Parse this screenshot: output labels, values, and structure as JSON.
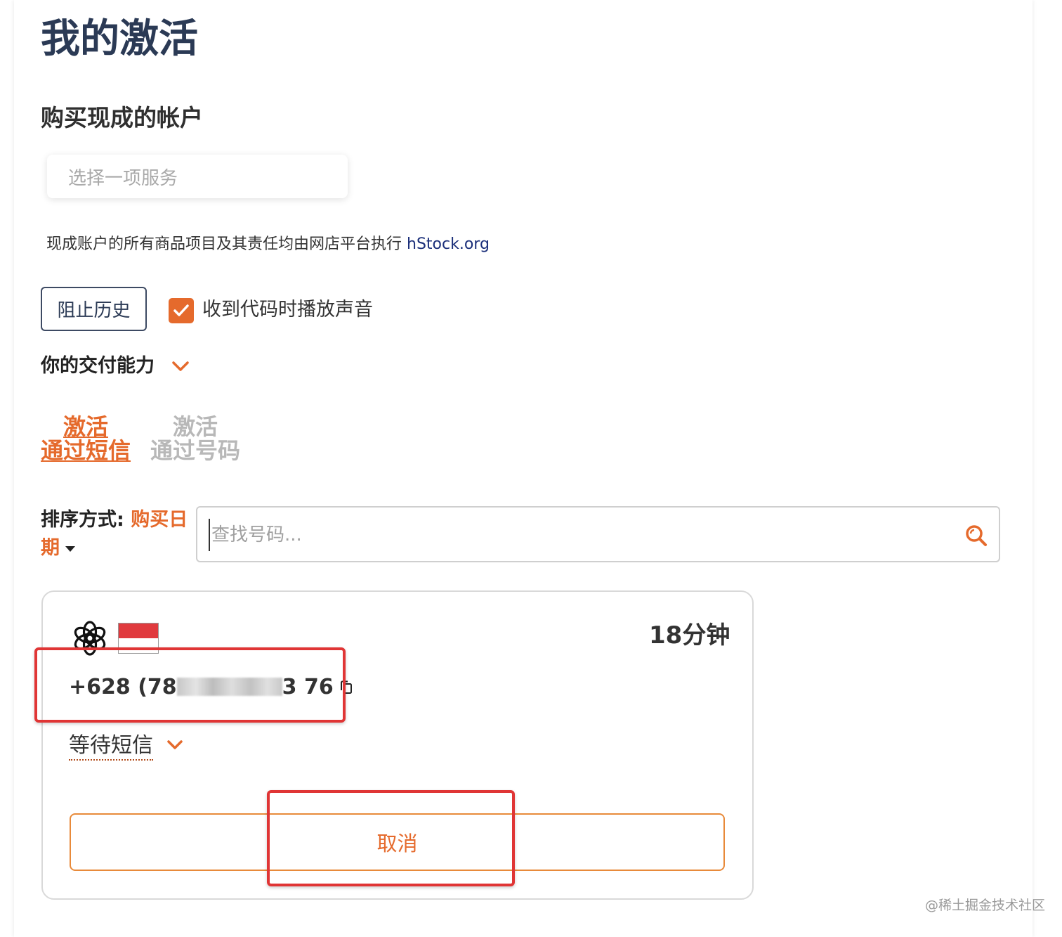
{
  "page": {
    "title": "我的激活",
    "subtitle": "购买现成的帐户"
  },
  "service_select": {
    "placeholder": "选择一项服务"
  },
  "disclaimer": {
    "text": "现成账户的所有商品项目及其责任均由网店平台执行 ",
    "link": "hStock.org"
  },
  "controls": {
    "block_history_label": "阻止历史",
    "sound_checkbox_checked": true,
    "sound_label": "收到代码时播放声音"
  },
  "delivery": {
    "label": "你的交付能力",
    "chevron_icon": "chevron-down-icon"
  },
  "tabs": [
    {
      "line1": "激活",
      "line2": "通过短信",
      "active": true
    },
    {
      "line1": "激活",
      "line2": "通过号码",
      "active": false
    }
  ],
  "sort": {
    "key": "排序方式: ",
    "value_part1": "购买日",
    "value_part2": "期"
  },
  "search": {
    "placeholder": "查找号码..."
  },
  "activation_card": {
    "service_icon": "openai-logo-icon",
    "country_flag": "indonesia-flag",
    "time_left": "18分钟",
    "phone_prefix": "+628 (78",
    "phone_suffix": "3 76",
    "status_label": "等待短信",
    "cancel_label": "取消"
  },
  "watermark": "@稀土掘金技术社区",
  "colors": {
    "accent": "#e56a2c",
    "title": "#2b3a55",
    "annotation_red": "#e03535",
    "link": "#1b2f7a"
  }
}
